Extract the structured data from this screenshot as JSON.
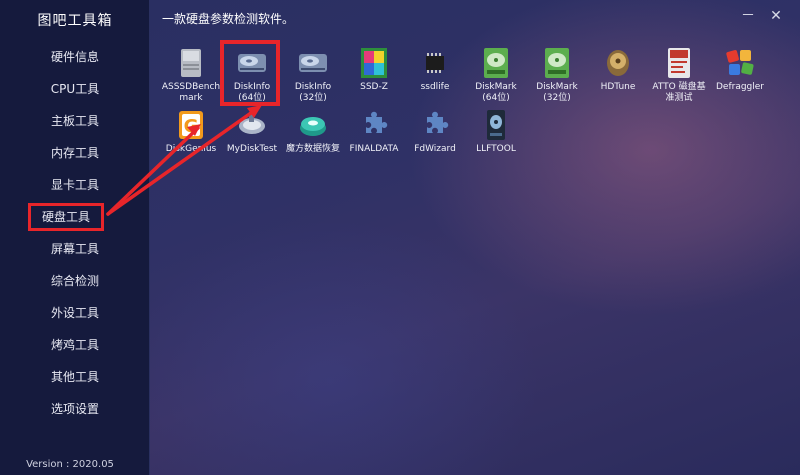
{
  "app": {
    "title": "图吧工具箱",
    "version": "Version : 2020.05"
  },
  "sidebar": {
    "items": [
      {
        "label": "硬件信息"
      },
      {
        "label": "CPU工具"
      },
      {
        "label": "主板工具"
      },
      {
        "label": "内存工具"
      },
      {
        "label": "显卡工具"
      },
      {
        "label": "硬盘工具"
      },
      {
        "label": "屏幕工具"
      },
      {
        "label": "综合检测"
      },
      {
        "label": "外设工具"
      },
      {
        "label": "烤鸡工具"
      },
      {
        "label": "其他工具"
      },
      {
        "label": "选项设置"
      }
    ],
    "selected": "硬盘工具"
  },
  "header": {
    "title": "一款硬盘参数检测软件。",
    "minimize_label": "－",
    "close_label": "✕"
  },
  "tools": [
    {
      "label": "ASSSDBench\nmark",
      "icon": "assd-icon"
    },
    {
      "label": "DiskInfo\n(64位)",
      "icon": "diskinfo-icon"
    },
    {
      "label": "DiskInfo\n(32位)",
      "icon": "diskinfo-icon"
    },
    {
      "label": "SSD-Z",
      "icon": "ssdz-icon"
    },
    {
      "label": "ssdlife",
      "icon": "chip-icon"
    },
    {
      "label": "DiskMark\n(64位)",
      "icon": "diskmark-icon"
    },
    {
      "label": "DiskMark\n(32位)",
      "icon": "diskmark-icon"
    },
    {
      "label": "HDTune",
      "icon": "hdtune-icon"
    },
    {
      "label": "ATTO  磁盘基\n准测试",
      "icon": "atto-icon"
    },
    {
      "label": "Defraggler",
      "icon": "defraggler-icon"
    },
    {
      "label": "DiskGenius",
      "icon": "diskgenius-icon"
    },
    {
      "label": "MyDiskTest",
      "icon": "mydisktest-icon"
    },
    {
      "label": "魔方数据恢复",
      "icon": "mofang-icon"
    },
    {
      "label": "FINALDATA",
      "icon": "puzzle-icon"
    },
    {
      "label": "FdWizard",
      "icon": "puzzle-icon"
    },
    {
      "label": "LLFTOOL",
      "icon": "llftool-icon"
    }
  ],
  "colors": {
    "highlight": "#e8252a",
    "sidebar_bg": "#151a3d"
  }
}
